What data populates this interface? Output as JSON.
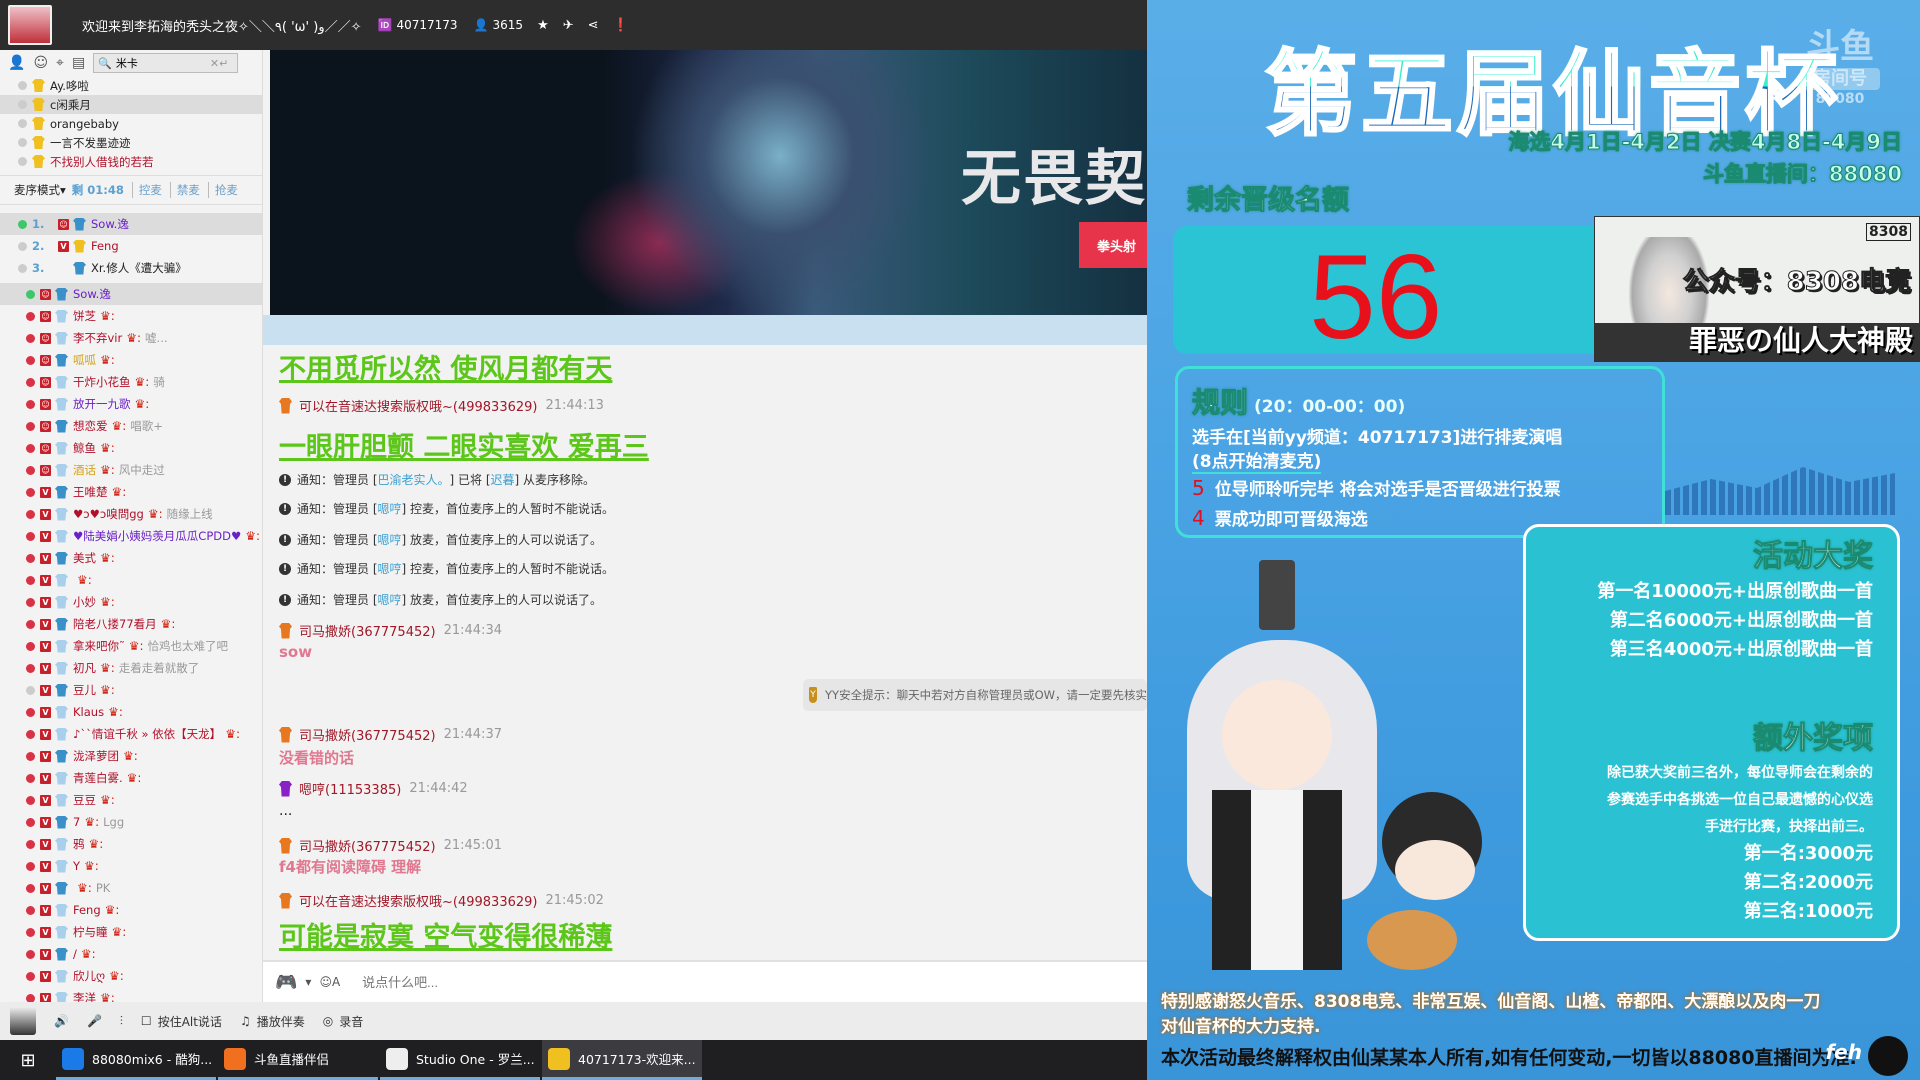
{
  "titlebar": {
    "title": "欢迎来到李拓海的秃头之夜✧＼＼٩( 'ω' )و／／✧",
    "channel_id": "40717173",
    "online": "3615"
  },
  "left": {
    "search_value": "米卡",
    "top_users": [
      {
        "name": "Ay.哆啦",
        "color": "#222"
      },
      {
        "name": "c闲乘月",
        "color": "#222",
        "sel": true
      },
      {
        "name": "orangebaby",
        "color": "#222"
      },
      {
        "name": "一言不发墨迹迹",
        "color": "#222"
      },
      {
        "name": "不找别人借钱的若若",
        "color": "#b0102a"
      }
    ],
    "mic_mode": "麦序模式",
    "timer": "剩 01:48",
    "mic_links": [
      "控麦",
      "禁麦",
      "抢麦"
    ],
    "queue": [
      {
        "num": "1.",
        "name": "Sow.逸",
        "color": "#6a1fc9",
        "badge": "S",
        "dot": "green"
      },
      {
        "num": "2.",
        "name": "Feng",
        "color": "#b0102a",
        "badge": "V",
        "dot": ""
      },
      {
        "num": "3.",
        "name": "Xr.修人《遭大骗》",
        "color": "#222",
        "badge": "",
        "dot": ""
      }
    ],
    "users": [
      {
        "name": "Sow.逸",
        "color": "#6a1fc9",
        "badge": "S",
        "dot": "green",
        "note": "",
        "crown": false,
        "sel": true
      },
      {
        "name": "饼芝",
        "color": "#b0102a",
        "badge": "S",
        "dot": "red",
        "note": "",
        "crown": true
      },
      {
        "name": "李不弃vir",
        "color": "#b0102a",
        "badge": "S",
        "dot": "red",
        "note": "嘘...",
        "crown": true
      },
      {
        "name": "呱呱",
        "color": "#d4a017",
        "badge": "S",
        "dot": "red",
        "note": "",
        "crown": true
      },
      {
        "name": "干炸小花鱼",
        "color": "#b0102a",
        "badge": "S",
        "dot": "red",
        "note": "骑",
        "crown": true
      },
      {
        "name": "放开一九歌",
        "color": "#6a1fc9",
        "badge": "S",
        "dot": "red",
        "note": "",
        "crown": true
      },
      {
        "name": "想恋爱",
        "color": "#b0102a",
        "badge": "S",
        "dot": "red",
        "note": "唱歌+",
        "crown": true
      },
      {
        "name": "鲸鱼",
        "color": "#b0102a",
        "badge": "S",
        "dot": "red",
        "note": "",
        "crown": true
      },
      {
        "name": "酒话",
        "color": "#d4a017",
        "badge": "S",
        "dot": "red",
        "note": "风中走过",
        "crown": true
      },
      {
        "name": "王唯楚",
        "color": "#b0102a",
        "badge": "V",
        "dot": "red",
        "note": "",
        "crown": true
      },
      {
        "name": "♥ɔ♥ɔ嗅問gg",
        "color": "#b0102a",
        "badge": "V",
        "dot": "red",
        "note": "随缘上线",
        "crown": true
      },
      {
        "name": "♥陆美娟小姨妈羡月瓜瓜CPDD♥",
        "color": "#6a1fc9",
        "badge": "V",
        "dot": "red",
        "note": "",
        "crown": true
      },
      {
        "name": "美式",
        "color": "#b0102a",
        "badge": "V",
        "dot": "red",
        "note": "",
        "crown": true
      },
      {
        "name": "",
        "color": "#b0102a",
        "badge": "V",
        "dot": "red",
        "note": "",
        "crown": true
      },
      {
        "name": "小妙",
        "color": "#b0102a",
        "badge": "V",
        "dot": "red",
        "note": "",
        "crown": true
      },
      {
        "name": "陪老八搂77看月",
        "color": "#b0102a",
        "badge": "V",
        "dot": "red",
        "note": "",
        "crown": true
      },
      {
        "name": "拿来吧你˜",
        "color": "#b0102a",
        "badge": "V",
        "dot": "red",
        "note": "恰鸡也太难了吧",
        "crown": true
      },
      {
        "name": "初凡",
        "color": "#b0102a",
        "badge": "V",
        "dot": "red",
        "note": "走着走着就散了",
        "crown": true
      },
      {
        "name": "豆儿",
        "color": "#b0102a",
        "badge": "V",
        "dot": "",
        "note": "",
        "crown": true
      },
      {
        "name": "Klaus",
        "color": "#b0102a",
        "badge": "V",
        "dot": "red",
        "note": "",
        "crown": true
      },
      {
        "name": "♪ˋˋ情谊千秋 » 依依【天龙】",
        "color": "#b0102a",
        "badge": "V",
        "dot": "red",
        "note": "",
        "crown": true
      },
      {
        "name": "泷泽萝团",
        "color": "#b0102a",
        "badge": "V",
        "dot": "red",
        "note": "",
        "crown": true
      },
      {
        "name": "青莲白雾.",
        "color": "#b0102a",
        "badge": "V",
        "dot": "red",
        "note": "",
        "crown": true
      },
      {
        "name": "豆豆",
        "color": "#b0102a",
        "badge": "V",
        "dot": "red",
        "note": "",
        "crown": true
      },
      {
        "name": "7",
        "color": "#b0102a",
        "badge": "V",
        "dot": "red",
        "note": "Lgg",
        "crown": true
      },
      {
        "name": "鸦",
        "color": "#b0102a",
        "badge": "V",
        "dot": "red",
        "note": "",
        "crown": true
      },
      {
        "name": "Y",
        "color": "#b0102a",
        "badge": "V",
        "dot": "red",
        "note": "",
        "crown": true
      },
      {
        "name": "",
        "color": "#b0102a",
        "badge": "V",
        "dot": "red",
        "note": "PK",
        "crown": true
      },
      {
        "name": "Feng",
        "color": "#b0102a",
        "badge": "V",
        "dot": "red",
        "note": "",
        "crown": true
      },
      {
        "name": "柠与瞳",
        "color": "#b0102a",
        "badge": "V",
        "dot": "red",
        "note": "",
        "crown": true
      },
      {
        "name": "/",
        "color": "#b0102a",
        "badge": "V",
        "dot": "red",
        "note": "",
        "crown": true
      },
      {
        "name": "欣儿ღ",
        "color": "#b0102a",
        "badge": "V",
        "dot": "red",
        "note": "",
        "crown": true
      },
      {
        "name": "李洋",
        "color": "#b0102a",
        "badge": "V",
        "dot": "red",
        "note": "",
        "crown": true
      }
    ]
  },
  "banner": {
    "title": "无畏契",
    "button": "拳头射"
  },
  "chat": [
    {
      "type": "big",
      "text": "不用觅所以然 使风月都有天"
    },
    {
      "type": "hdr",
      "name": "可以在音速达搜索版权哦~(499833629)",
      "time": "21:44:13"
    },
    {
      "type": "big",
      "text": "一眼肝胆颤 二眼实喜欢 爱再三"
    },
    {
      "type": "notice",
      "pre": "通知：管理员 [",
      "who": "巴渝老实人。",
      "mid": "] 已将 [",
      "who2": "迟暮",
      "post": "] 从麦序移除。"
    },
    {
      "type": "notice",
      "pre": "通知：管理员 [",
      "who": "嗯哼",
      "post": "] 控麦，首位麦序上的人暂时不能说话。"
    },
    {
      "type": "notice",
      "pre": "通知：管理员 [",
      "who": "嗯哼",
      "post": "] 放麦，首位麦序上的人可以说话了。"
    },
    {
      "type": "notice",
      "pre": "通知：管理员 [",
      "who": "嗯哼",
      "post": "] 控麦，首位麦序上的人暂时不能说话。"
    },
    {
      "type": "notice",
      "pre": "通知：管理员 [",
      "who": "嗯哼",
      "post": "] 放麦，首位麦序上的人可以说话了。"
    },
    {
      "type": "hdr",
      "name": "司马撒娇(367775452)",
      "time": "21:44:34"
    },
    {
      "type": "pink",
      "text": "sow"
    },
    {
      "type": "hdr",
      "name": "司马撒娇(367775452)",
      "time": "21:44:37"
    },
    {
      "type": "pink",
      "text": "没看错的话"
    },
    {
      "type": "hdr",
      "name": "嗯哼(11153385)",
      "time": "21:44:42",
      "purple": true
    },
    {
      "type": "plain",
      "text": "..."
    },
    {
      "type": "hdr",
      "name": "司马撒娇(367775452)",
      "time": "21:45:01"
    },
    {
      "type": "pink",
      "text": "f4都有阅读障碍 理解"
    },
    {
      "type": "hdr",
      "name": "可以在音速达搜索版权哦~(499833629)",
      "time": "21:45:02"
    },
    {
      "type": "big",
      "text": "可能是寂寞 空气变得很稀薄"
    }
  ],
  "yytip": {
    "badge": "Y",
    "text": "YY安全提示：聊天中若对方自称管理员或OW，请一定要先核实"
  },
  "input": {
    "placeholder": "说点什么吧..."
  },
  "toolbar": {
    "ptt": "按住Alt说话",
    "accompany": "播放伴奏",
    "record": "录音"
  },
  "taskbar": [
    {
      "label": "88080mix6 - 酷狗...",
      "color": "#1a7ae8"
    },
    {
      "label": "斗鱼直播伴侣",
      "color": "#f07020"
    },
    {
      "label": "Studio One - 罗兰...",
      "color": "#eeeeee"
    },
    {
      "label": "40717173-欢迎来...",
      "color": "#f0c020",
      "active": true
    }
  ],
  "overlay": {
    "title": "第五届仙音杯",
    "logo": {
      "brand": "斗鱼",
      "room_label": "房间号",
      "room": "88080"
    },
    "dates": "海选4月1日-4月2日 决赛4月8日-4月9日",
    "room": "斗鱼直播间：88080",
    "remaining_label": "剩余晋级名额",
    "remaining": "56",
    "cam": {
      "logo": "8308",
      "gzh": "公众号：8308电竞",
      "hall": "罪恶の仙人大神殿"
    },
    "rules": {
      "title": "规则",
      "time": "(20：00-00：00)",
      "line1": "选手在[当前yy频道：40717173]进行排麦演唱",
      "line2": "(8点开始清麦克)",
      "n1": "5",
      "line3": "位导师聆听完毕 将会对选手是否晋级进行投票",
      "n2": "4",
      "line4": "票成功即可晋级海选"
    },
    "prize": {
      "title": "活动大奖",
      "items": [
        "第一名10000元+出原创歌曲一首",
        "第二名6000元+出原创歌曲一首",
        "第三名4000元+出原创歌曲一首"
      ],
      "extra_title": "额外奖项",
      "extra_desc": [
        "除已获大奖前三名外，每位导师会在剩余的",
        "参赛选手中各挑选一位自己最遗憾的心仪选",
        "手进行比赛，抉择出前三。"
      ],
      "extra_items": [
        "第一名:3000元",
        "第二名:2000元",
        "第三名:1000元"
      ]
    },
    "thanks": [
      "特别感谢怒火音乐、8308电竞、非常互娱、仙音阁、山楂、帝都阳、大漂酿以及肉一刀",
      "对仙音杯的大力支持."
    ],
    "disclaimer": "本次活动最终解释权由仙某某本人所有,如有任何变动,一切皆以88080直播间为准.",
    "sponsor": "feh"
  }
}
